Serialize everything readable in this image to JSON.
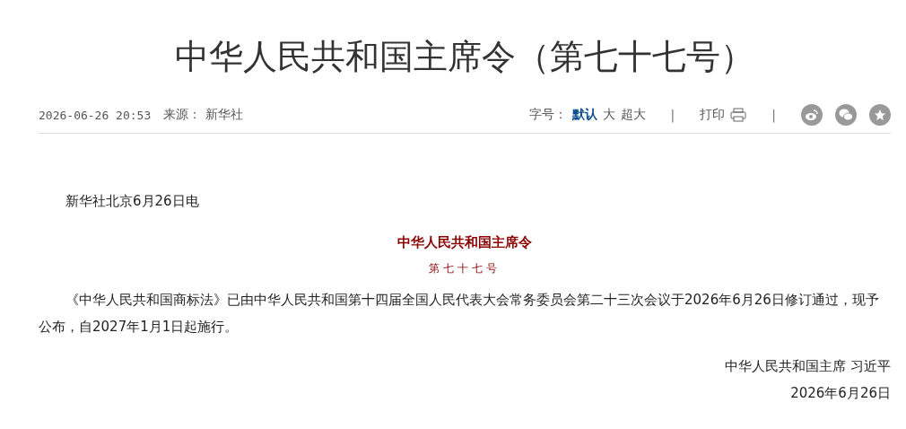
{
  "article": {
    "title": "中华人民共和国主席令（第七十七号）"
  },
  "meta": {
    "datetime": "2026-06-26 20:53",
    "source_label": "来源：",
    "source": "新华社"
  },
  "toolbar": {
    "font_size_label": "字号：",
    "font_sizes": [
      {
        "label": "默认",
        "selected": true
      },
      {
        "label": "大",
        "selected": false
      },
      {
        "label": "超大",
        "selected": false
      }
    ],
    "separator": "|",
    "print_label": "打印",
    "separator_2": "|"
  },
  "body": {
    "dateline": "新华社北京6月26日电",
    "order_title": "中华人民共和国主席令",
    "order_number": "第七十七号",
    "paragraph": "《中华人民共和国商标法》已由中华人民共和国第十四届全国人民代表大会常务委员会第二十三次会议于2026年6月26日修订通过，现予公布，自2027年1月1日起施行。",
    "signature": "中华人民共和国主席 习近平",
    "date": "2026年6月26日"
  }
}
